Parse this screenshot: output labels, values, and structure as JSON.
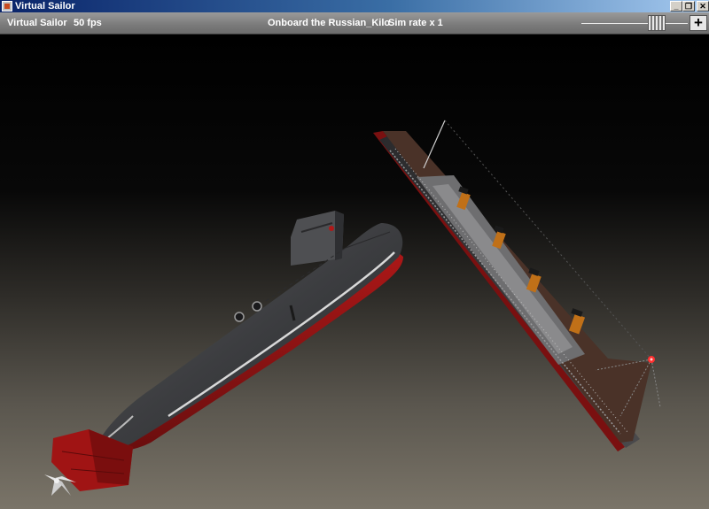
{
  "window": {
    "title": "Virtual Sailor",
    "controls": {
      "minimize": "_",
      "restore": "❐",
      "close": "✕"
    }
  },
  "status_bar": {
    "app_name": "Virtual Sailor",
    "fps": "50 fps",
    "onboard": "Onboard the Russian_Kilo",
    "sim_rate": "Sim rate x 1",
    "zoom_plus": "+"
  },
  "scene": {
    "objects": [
      "russian-kilo-submarine",
      "ocean-liner"
    ],
    "colors": {
      "submarine_hull": "#3c3d40",
      "antifouling_red": "#8e1414",
      "liner_deck": "#4a3228",
      "liner_funnel": "#c07018",
      "sea_fog": "#7a7468"
    }
  }
}
